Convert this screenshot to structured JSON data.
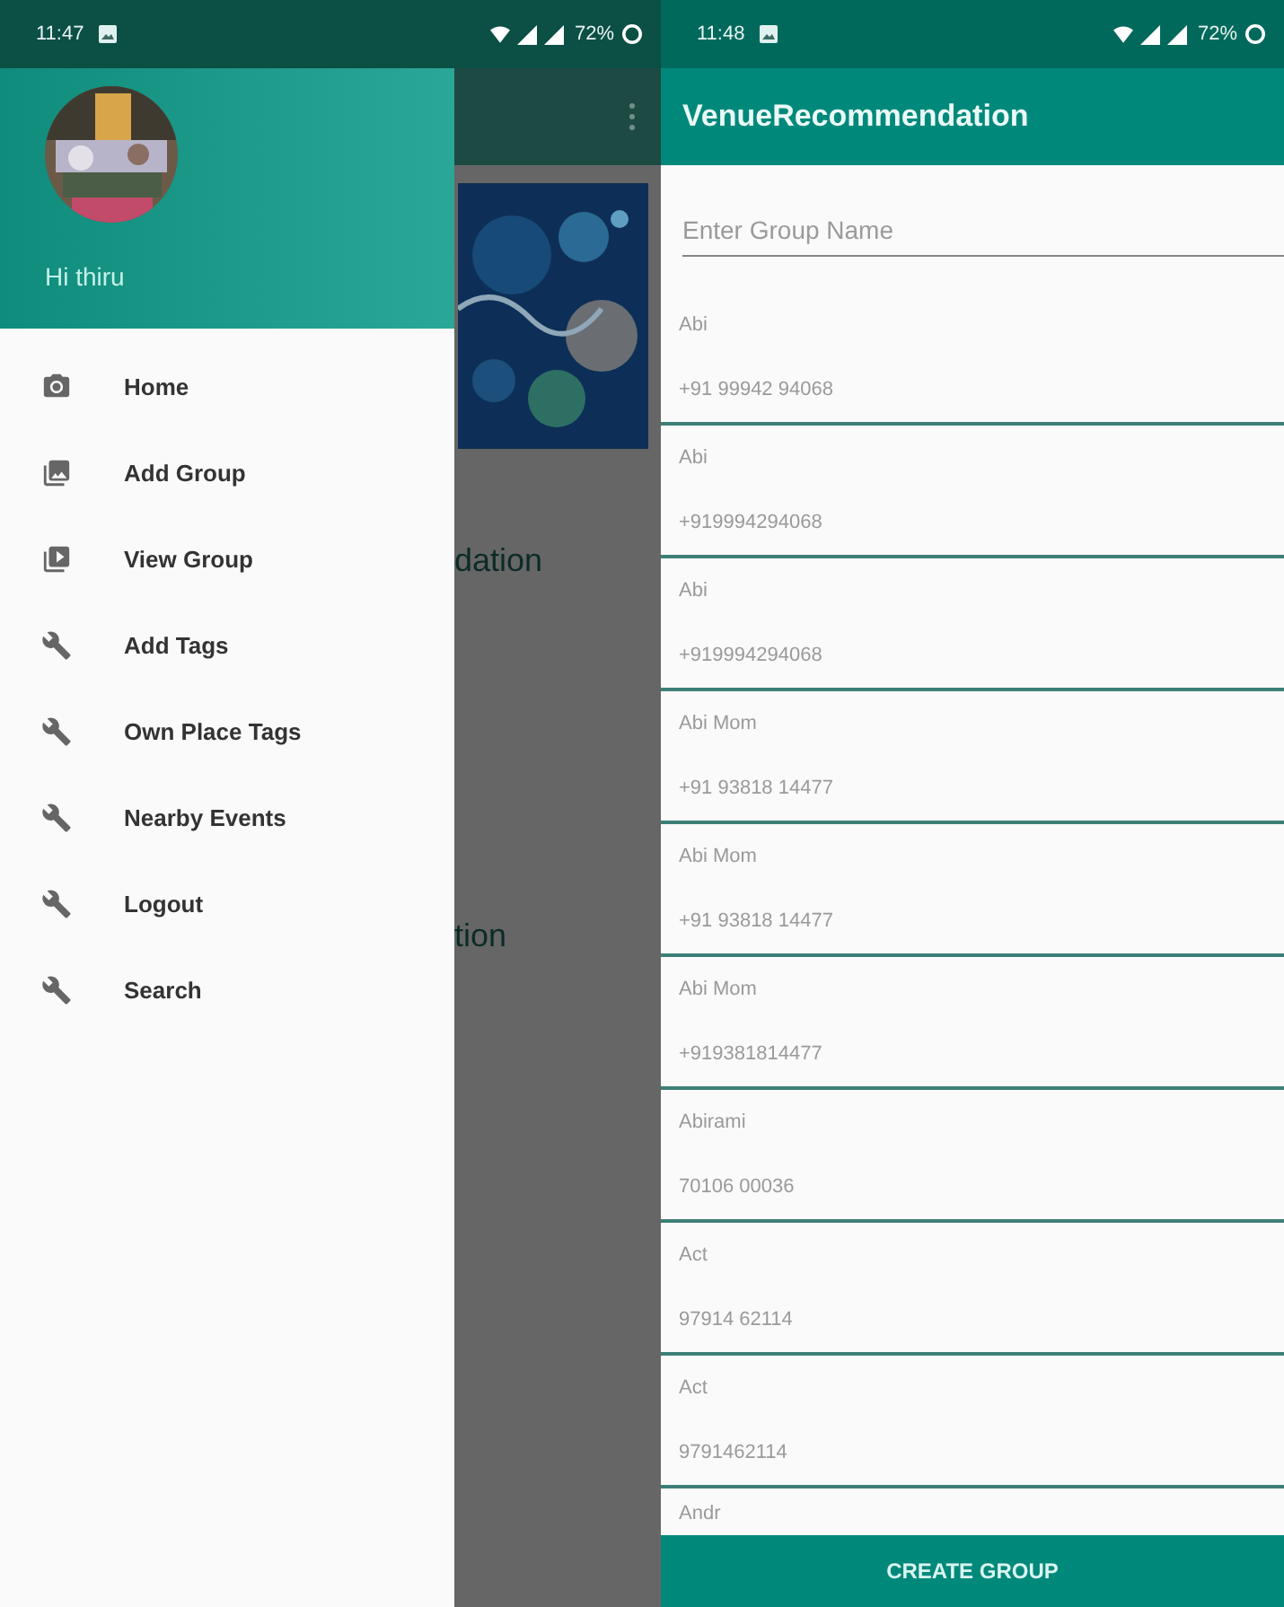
{
  "drawer_screen": {
    "status_bar": {
      "time": "11:47",
      "battery": "72%"
    },
    "drawer": {
      "greeting": "Hi thiru",
      "items": [
        {
          "label": "Home",
          "kind": "camera"
        },
        {
          "label": "Add Group",
          "kind": "photos"
        },
        {
          "label": "View Group",
          "kind": "video"
        },
        {
          "label": "Add Tags",
          "kind": "wrench"
        },
        {
          "label": "Own Place Tags",
          "kind": "wrench"
        },
        {
          "label": "Nearby Events",
          "kind": "wrench"
        },
        {
          "label": "Logout",
          "kind": "wrench"
        },
        {
          "label": "Search",
          "kind": "wrench"
        }
      ]
    },
    "background": {
      "texts": [
        "dation",
        "tion"
      ]
    }
  },
  "group_screen": {
    "status_bar": {
      "time": "11:48",
      "battery": "72%"
    },
    "title": "VenueRecommendation",
    "group_name": {
      "placeholder": "Enter Group Name"
    },
    "contacts": [
      {
        "name": "Abi",
        "phone": "+91 99942 94068"
      },
      {
        "name": "Abi",
        "phone": "+919994294068"
      },
      {
        "name": "Abi",
        "phone": "+919994294068"
      },
      {
        "name": "Abi Mom",
        "phone": "+91 93818 14477"
      },
      {
        "name": "Abi Mom",
        "phone": "+91 93818 14477"
      },
      {
        "name": "Abi Mom",
        "phone": "+919381814477"
      },
      {
        "name": "Abirami",
        "phone": "70106 00036"
      },
      {
        "name": "Act",
        "phone": "97914 62114"
      },
      {
        "name": "Act",
        "phone": "9791462114"
      },
      {
        "name": "Andr"
      }
    ],
    "button": "CREATE GROUP"
  }
}
